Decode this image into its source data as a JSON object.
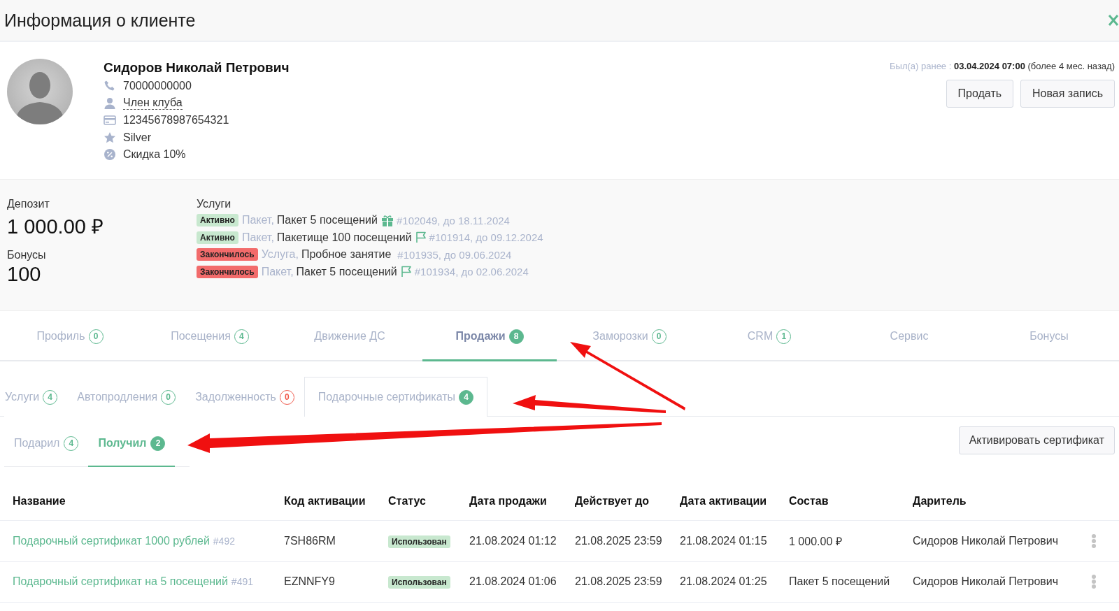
{
  "header": {
    "title": "Информация о клиенте"
  },
  "client": {
    "name": "Сидоров Николай Петрович",
    "details": [
      {
        "kind": "phone",
        "text": "70000000000"
      },
      {
        "kind": "person",
        "text": "Член клуба",
        "dashed": true
      },
      {
        "kind": "card",
        "text": "12345678987654321"
      },
      {
        "kind": "star",
        "text": "Silver"
      },
      {
        "kind": "discount",
        "text": "Скидка 10%"
      }
    ],
    "last_visit": {
      "label": "Был(а) ранее :",
      "date": "03.04.2024 07:00",
      "ago": "(более 4 мес. назад)"
    },
    "buttons": [
      "Продать",
      "Новая запись"
    ]
  },
  "balance": {
    "deposit_label": "Депозит",
    "deposit": "1 000.00 ₽",
    "bonus_label": "Бонусы",
    "bonus": "100"
  },
  "services": {
    "title": "Услуги",
    "items": [
      {
        "kind": "gift",
        "expired": false,
        "status_label": "Активно",
        "type": "Пакет,",
        "name": "Пакет 5 посещений",
        "ref": "#102049, до 18.11.2024"
      },
      {
        "kind": "flag",
        "expired": false,
        "status_label": "Активно",
        "type": "Пакет,",
        "name": "Пакетище 100 посещений",
        "ref": "#101914, до 09.12.2024"
      },
      {
        "kind": "plain",
        "expired": true,
        "status_label": "Закончилось",
        "type": "Услуга,",
        "name": "Пробное занятие",
        "ref": "#101935, до 09.06.2024"
      },
      {
        "kind": "flag",
        "expired": true,
        "status_label": "Закончилось",
        "type": "Пакет,",
        "name": "Пакет 5 посещений",
        "ref": "#101934, до 02.06.2024"
      }
    ]
  },
  "tabs": [
    {
      "label": "Профиль",
      "count": "0",
      "selected": false
    },
    {
      "label": "Посещения",
      "count": "4",
      "selected": false
    },
    {
      "label": "Движение ДС",
      "selected": false
    },
    {
      "label": "Продажи",
      "count": "8",
      "selected": true
    },
    {
      "label": "Заморозки",
      "count": "0",
      "selected": false
    },
    {
      "label": "CRM",
      "count": "1",
      "selected": false
    },
    {
      "label": "Сервис",
      "selected": false
    },
    {
      "label": "Бонусы",
      "selected": false
    }
  ],
  "subtabs": [
    {
      "label": "Услуги",
      "count": "4",
      "color": "#5cb88f",
      "selected": false
    },
    {
      "label": "Автопродления",
      "count": "0",
      "color": "#5cb88f",
      "selected": false
    },
    {
      "label": "Задолженность",
      "count": "0",
      "color": "#f0584a",
      "selected": false
    },
    {
      "label": "Подарочные сертификаты",
      "count": "4",
      "color": "#5cb88f",
      "selected": true
    }
  ],
  "filter_tabs": [
    {
      "label": "Подарил",
      "count": "4",
      "selected": false
    },
    {
      "label": "Получил",
      "count": "2",
      "selected": true
    }
  ],
  "activate_button": "Активировать сертификат",
  "table": {
    "columns": [
      "Название",
      "Код активации",
      "Статус",
      "Дата продажи",
      "Действует до",
      "Дата активации",
      "Состав",
      "Даритель"
    ],
    "rows": [
      {
        "name": "Подарочный сертификат 1000 рублей",
        "ref": "#492",
        "code": "7SH86RM",
        "status": "Использован",
        "sold": "21.08.2024 01:12",
        "valid_until": "21.08.2025 23:59",
        "activated": "21.08.2024 01:15",
        "contents": "1 000.00 ₽",
        "giver": "Сидоров Николай Петрович"
      },
      {
        "name": "Подарочный сертификат на 5 посещений",
        "ref": "#491",
        "code": "EZNNFY9",
        "status": "Использован",
        "sold": "21.08.2024 01:06",
        "valid_until": "21.08.2025 23:59",
        "activated": "21.08.2024 01:25",
        "contents": "Пакет 5 посещений",
        "giver": "Сидоров Николай Петрович"
      }
    ]
  }
}
